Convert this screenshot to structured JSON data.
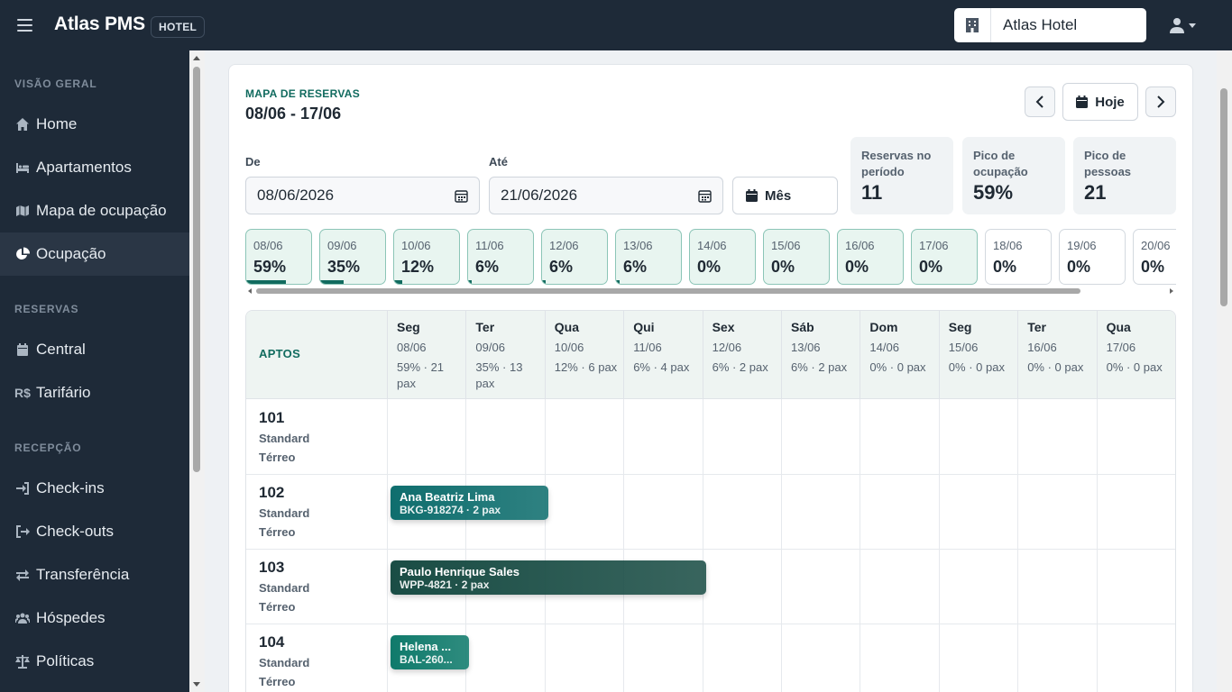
{
  "topbar": {
    "brand": "Atlas PMS",
    "badge": "HOTEL",
    "hotel": "Atlas Hotel"
  },
  "sidebar": {
    "sections": [
      {
        "title": "VISÃO GERAL",
        "items": [
          {
            "label": "Home",
            "icon": "home-icon"
          },
          {
            "label": "Apartamentos",
            "icon": "bed-icon"
          },
          {
            "label": "Mapa de ocupação",
            "icon": "map-icon"
          },
          {
            "label": "Ocupação",
            "icon": "pie-chart-icon",
            "active": true
          }
        ]
      },
      {
        "title": "RESERVAS",
        "items": [
          {
            "label": "Central",
            "icon": "calendar-icon"
          },
          {
            "label": "Tarifário",
            "icon": "currency-icon"
          }
        ]
      },
      {
        "title": "RECEPÇÃO",
        "items": [
          {
            "label": "Check-ins",
            "icon": "sign-in-icon"
          },
          {
            "label": "Check-outs",
            "icon": "sign-out-icon"
          },
          {
            "label": "Transferência",
            "icon": "exchange-icon"
          },
          {
            "label": "Hóspedes",
            "icon": "users-icon"
          },
          {
            "label": "Políticas",
            "icon": "scale-icon"
          }
        ]
      }
    ]
  },
  "header": {
    "kicker": "MAPA DE RESERVAS",
    "range": "08/06 - 17/06",
    "today_label": "Hoje"
  },
  "filters": {
    "from_label": "De",
    "from_value": "08/06/2026",
    "to_label": "Até",
    "to_value": "21/06/2026",
    "month_label": "Mês"
  },
  "stats": [
    {
      "label": "Reservas no período",
      "value": "11"
    },
    {
      "label": "Pico de ocupação",
      "value": "59%"
    },
    {
      "label": "Pico de pessoas",
      "value": "21"
    }
  ],
  "days": [
    {
      "date": "08/06",
      "pct": "59%",
      "fill": 0.59
    },
    {
      "date": "09/06",
      "pct": "35%",
      "fill": 0.35
    },
    {
      "date": "10/06",
      "pct": "12%",
      "fill": 0.12
    },
    {
      "date": "11/06",
      "pct": "6%",
      "fill": 0.06
    },
    {
      "date": "12/06",
      "pct": "6%",
      "fill": 0.06
    },
    {
      "date": "13/06",
      "pct": "6%",
      "fill": 0.06
    },
    {
      "date": "14/06",
      "pct": "0%",
      "fill": 0
    },
    {
      "date": "15/06",
      "pct": "0%",
      "fill": 0
    },
    {
      "date": "16/06",
      "pct": "0%",
      "fill": 0
    },
    {
      "date": "17/06",
      "pct": "0%",
      "fill": 0
    },
    {
      "date": "18/06",
      "pct": "0%",
      "fill": 0,
      "empty": true
    },
    {
      "date": "19/06",
      "pct": "0%",
      "fill": 0,
      "empty": true
    },
    {
      "date": "20/06",
      "pct": "0%",
      "fill": 0,
      "empty": true
    }
  ],
  "grid": {
    "room_header": "APTOS",
    "columns": [
      {
        "weekday": "Seg",
        "date": "08/06",
        "occ": "59% · 21 pax"
      },
      {
        "weekday": "Ter",
        "date": "09/06",
        "occ": "35% · 13 pax"
      },
      {
        "weekday": "Qua",
        "date": "10/06",
        "occ": "12% · 6 pax"
      },
      {
        "weekday": "Qui",
        "date": "11/06",
        "occ": "6% · 4 pax"
      },
      {
        "weekday": "Sex",
        "date": "12/06",
        "occ": "6% · 2 pax"
      },
      {
        "weekday": "Sáb",
        "date": "13/06",
        "occ": "6% · 2 pax"
      },
      {
        "weekday": "Dom",
        "date": "14/06",
        "occ": "0% · 0 pax"
      },
      {
        "weekday": "Seg",
        "date": "15/06",
        "occ": "0% · 0 pax"
      },
      {
        "weekday": "Ter",
        "date": "16/06",
        "occ": "0% · 0 pax"
      },
      {
        "weekday": "Qua",
        "date": "17/06",
        "occ": "0% · 0 pax"
      }
    ],
    "rooms": [
      {
        "number": "101",
        "type": "Standard",
        "floor": "Térreo"
      },
      {
        "number": "102",
        "type": "Standard",
        "floor": "Térreo"
      },
      {
        "number": "103",
        "type": "Standard",
        "floor": "Térreo"
      },
      {
        "number": "104",
        "type": "Standard",
        "floor": "Térreo"
      }
    ],
    "bookings": [
      {
        "room": 1,
        "start": 0,
        "nights": 2,
        "guest": "Ana Beatriz Lima",
        "code": "BKG-918274 · 2 pax",
        "color": "#0f6e6e"
      },
      {
        "room": 2,
        "start": 0,
        "nights": 4,
        "guest": "Paulo Henrique Sales",
        "code": "WPP-4821 · 2 pax",
        "color": "#1a4d45"
      },
      {
        "room": 3,
        "start": 0,
        "nights": 1,
        "guest": "Helena ...",
        "code": "BAL-260...",
        "color": "#0f7a6b"
      }
    ]
  },
  "colors": {
    "accent": "#116b5f",
    "topbar": "#1e2a38"
  }
}
